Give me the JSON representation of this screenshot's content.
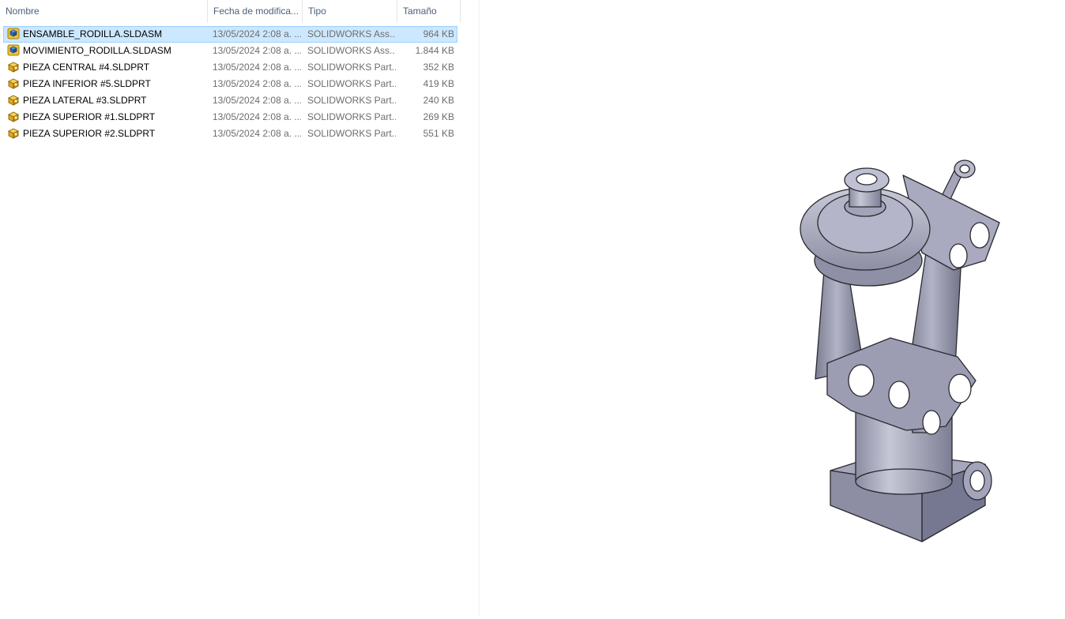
{
  "columns": {
    "name": "Nombre",
    "date": "Fecha de modifica...",
    "type": "Tipo",
    "size": "Tamaño"
  },
  "sort_indicator": "^",
  "files": [
    {
      "name": "ENSAMBLE_RODILLA.SLDASM",
      "date": "13/05/2024 2:08 a. ...",
      "type": "SOLIDWORKS Ass...",
      "size": "964 KB",
      "icon": "assembly-icon",
      "selected": true
    },
    {
      "name": "MOVIMIENTO_RODILLA.SLDASM",
      "date": "13/05/2024 2:08 a. ...",
      "type": "SOLIDWORKS Ass...",
      "size": "1.844 KB",
      "icon": "assembly-icon",
      "selected": false
    },
    {
      "name": "PIEZA CENTRAL  #4.SLDPRT",
      "date": "13/05/2024 2:08 a. ...",
      "type": "SOLIDWORKS Part...",
      "size": "352 KB",
      "icon": "part-icon",
      "selected": false
    },
    {
      "name": "PIEZA INFERIOR #5.SLDPRT",
      "date": "13/05/2024 2:08 a. ...",
      "type": "SOLIDWORKS Part...",
      "size": "419 KB",
      "icon": "part-icon",
      "selected": false
    },
    {
      "name": "PIEZA LATERAL #3.SLDPRT",
      "date": "13/05/2024 2:08 a. ...",
      "type": "SOLIDWORKS Part...",
      "size": "240 KB",
      "icon": "part-icon",
      "selected": false
    },
    {
      "name": "PIEZA SUPERIOR #1.SLDPRT",
      "date": "13/05/2024 2:08 a. ...",
      "type": "SOLIDWORKS Part...",
      "size": "269 KB",
      "icon": "part-icon",
      "selected": false
    },
    {
      "name": "PIEZA SUPERIOR #2.SLDPRT",
      "date": "13/05/2024 2:08 a. ...",
      "type": "SOLIDWORKS Part...",
      "size": "551 KB",
      "icon": "part-icon",
      "selected": false
    }
  ],
  "colors": {
    "selection": "#cce8ff",
    "header_text": "#4c607a",
    "model_body": "#9a9bb0",
    "model_edge": "#2a2a30"
  }
}
